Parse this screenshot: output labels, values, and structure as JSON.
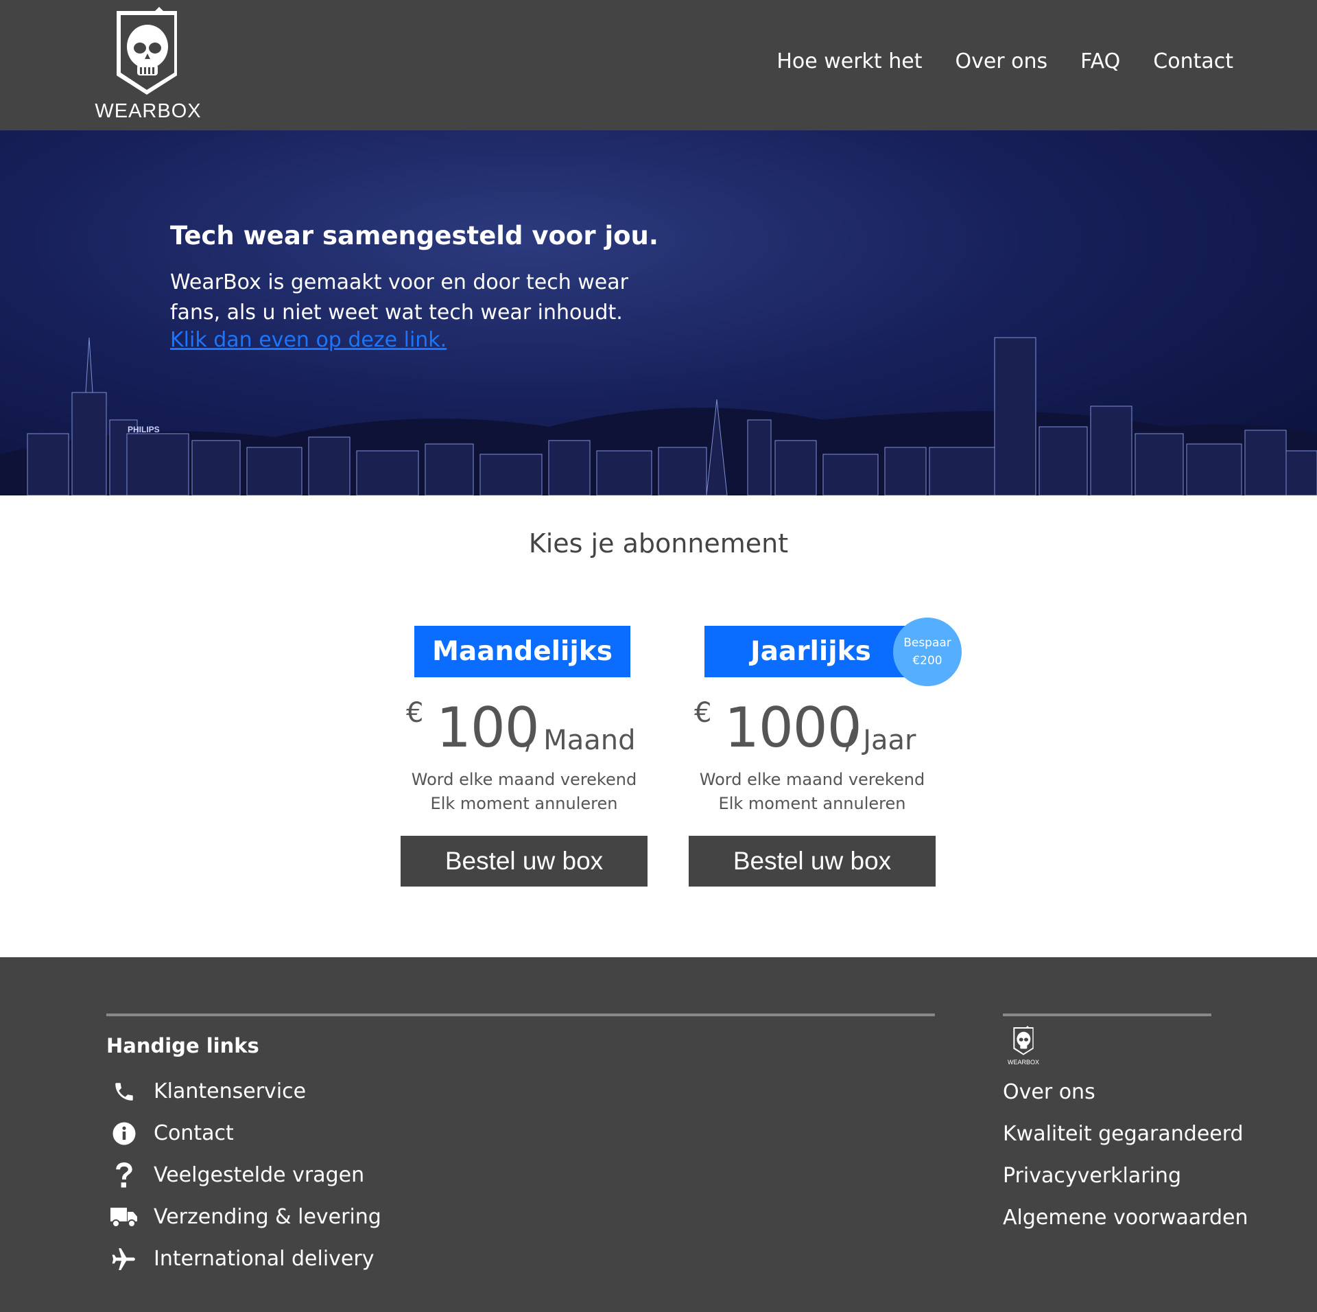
{
  "brand": {
    "name": "WEARBOX"
  },
  "nav": {
    "items": [
      "Hoe werkt het",
      "Over ons",
      "FAQ",
      "Contact"
    ]
  },
  "hero": {
    "title": "Tech wear samengesteld voor jou.",
    "text": "WearBox is gemaakt voor en door tech wear fans, als u niet weet wat tech wear inhoudt.",
    "link": "Klik dan even op deze link.",
    "skyline_sign": "PHILIPS"
  },
  "pricing": {
    "title": "Kies je abonnement",
    "plans": [
      {
        "tag": "Maandelijks",
        "currency": "€",
        "price": "100",
        "unit": "/ Maand",
        "note1": "Word elke maand verekend",
        "note2": "Elk moment annuleren",
        "button": "Bestel uw box"
      },
      {
        "tag": "Jaarlijks",
        "badge_line1": "Bespaar",
        "badge_line2": "€200",
        "currency": "€",
        "price": "1000",
        "unit": "/ Jaar",
        "note1": "Word elke maand verekend",
        "note2": "Elk moment annuleren",
        "button": "Bestel uw box"
      }
    ]
  },
  "footer": {
    "heading": "Handige links",
    "links": [
      {
        "label": "Klantenservice",
        "icon": "phone-icon"
      },
      {
        "label": "Contact",
        "icon": "info-icon"
      },
      {
        "label": "Veelgestelde vragen",
        "icon": "question-icon"
      },
      {
        "label": "Verzending & levering",
        "icon": "truck-icon"
      },
      {
        "label": "International delivery",
        "icon": "plane-icon"
      }
    ],
    "logo_text": "WEARBOX",
    "right_links": [
      "Over ons",
      "Kwaliteit gegarandeerd",
      "Privacyverklaring",
      "Algemene voorwaarden"
    ]
  },
  "colors": {
    "header_bg": "#444444",
    "accent_blue": "#0b6dff",
    "badge_blue": "#55aeff",
    "link_blue": "#1a76ff"
  }
}
